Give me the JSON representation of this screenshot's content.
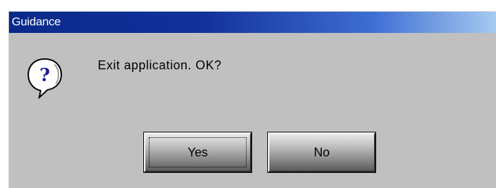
{
  "window": {
    "title": "Guidance"
  },
  "dialog": {
    "icon": "question-balloon-icon",
    "message": "Exit application. OK?"
  },
  "buttons": {
    "yes_label": "Yes",
    "no_label": "No"
  },
  "colors": {
    "dialog_bg": "#c0c0c0",
    "titlebar_start": "#0a2a8a",
    "titlebar_end": "#a6caf0",
    "title_text": "#ffffff",
    "icon_fill": "#1a1aa0"
  }
}
